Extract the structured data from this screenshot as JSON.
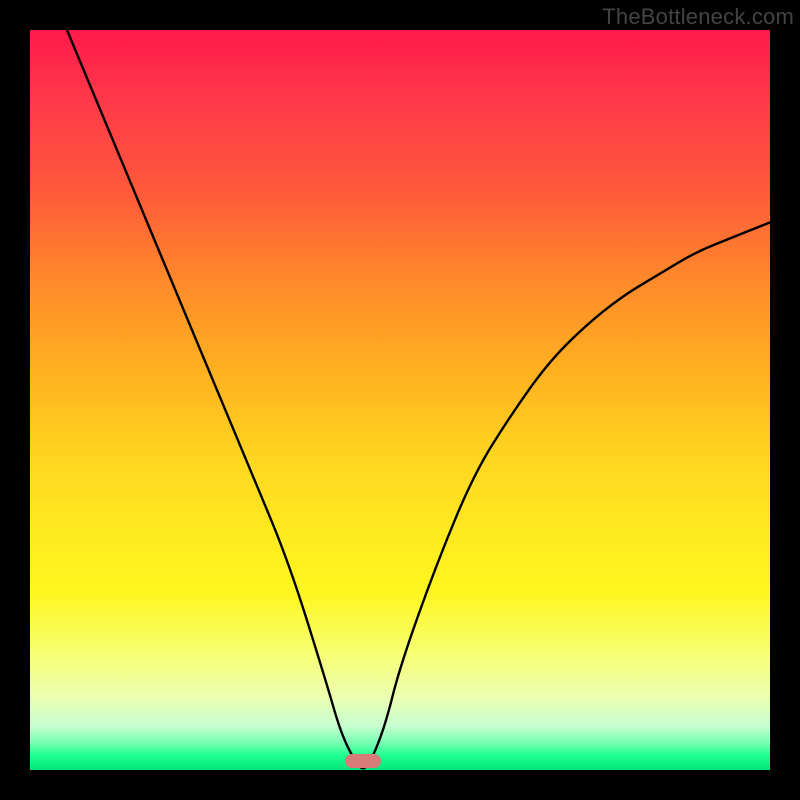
{
  "watermark": "TheBottleneck.com",
  "chart_data": {
    "type": "line",
    "title": "",
    "xlabel": "",
    "ylabel": "",
    "xlim": [
      0,
      100
    ],
    "ylim": [
      0,
      100
    ],
    "grid": false,
    "legend": false,
    "series": [
      {
        "name": "bottleneck-curve",
        "x": [
          5,
          10,
          15,
          20,
          25,
          30,
          35,
          40,
          42,
          44,
          45,
          46,
          48,
          50,
          55,
          60,
          65,
          70,
          75,
          80,
          85,
          90,
          95,
          100
        ],
        "y": [
          100,
          88,
          76,
          64,
          52,
          40,
          28,
          12,
          5,
          1,
          0,
          1,
          6,
          14,
          28,
          40,
          48,
          55,
          60,
          64,
          67,
          70,
          72,
          74
        ]
      }
    ],
    "marker": {
      "name": "optimal-point",
      "x": 45,
      "y": 0,
      "color": "#d77a7a"
    },
    "background_gradient": {
      "top": "#ff1a4a",
      "bottom": "#00e878",
      "meaning": "red=high bottleneck, green=low bottleneck"
    }
  }
}
